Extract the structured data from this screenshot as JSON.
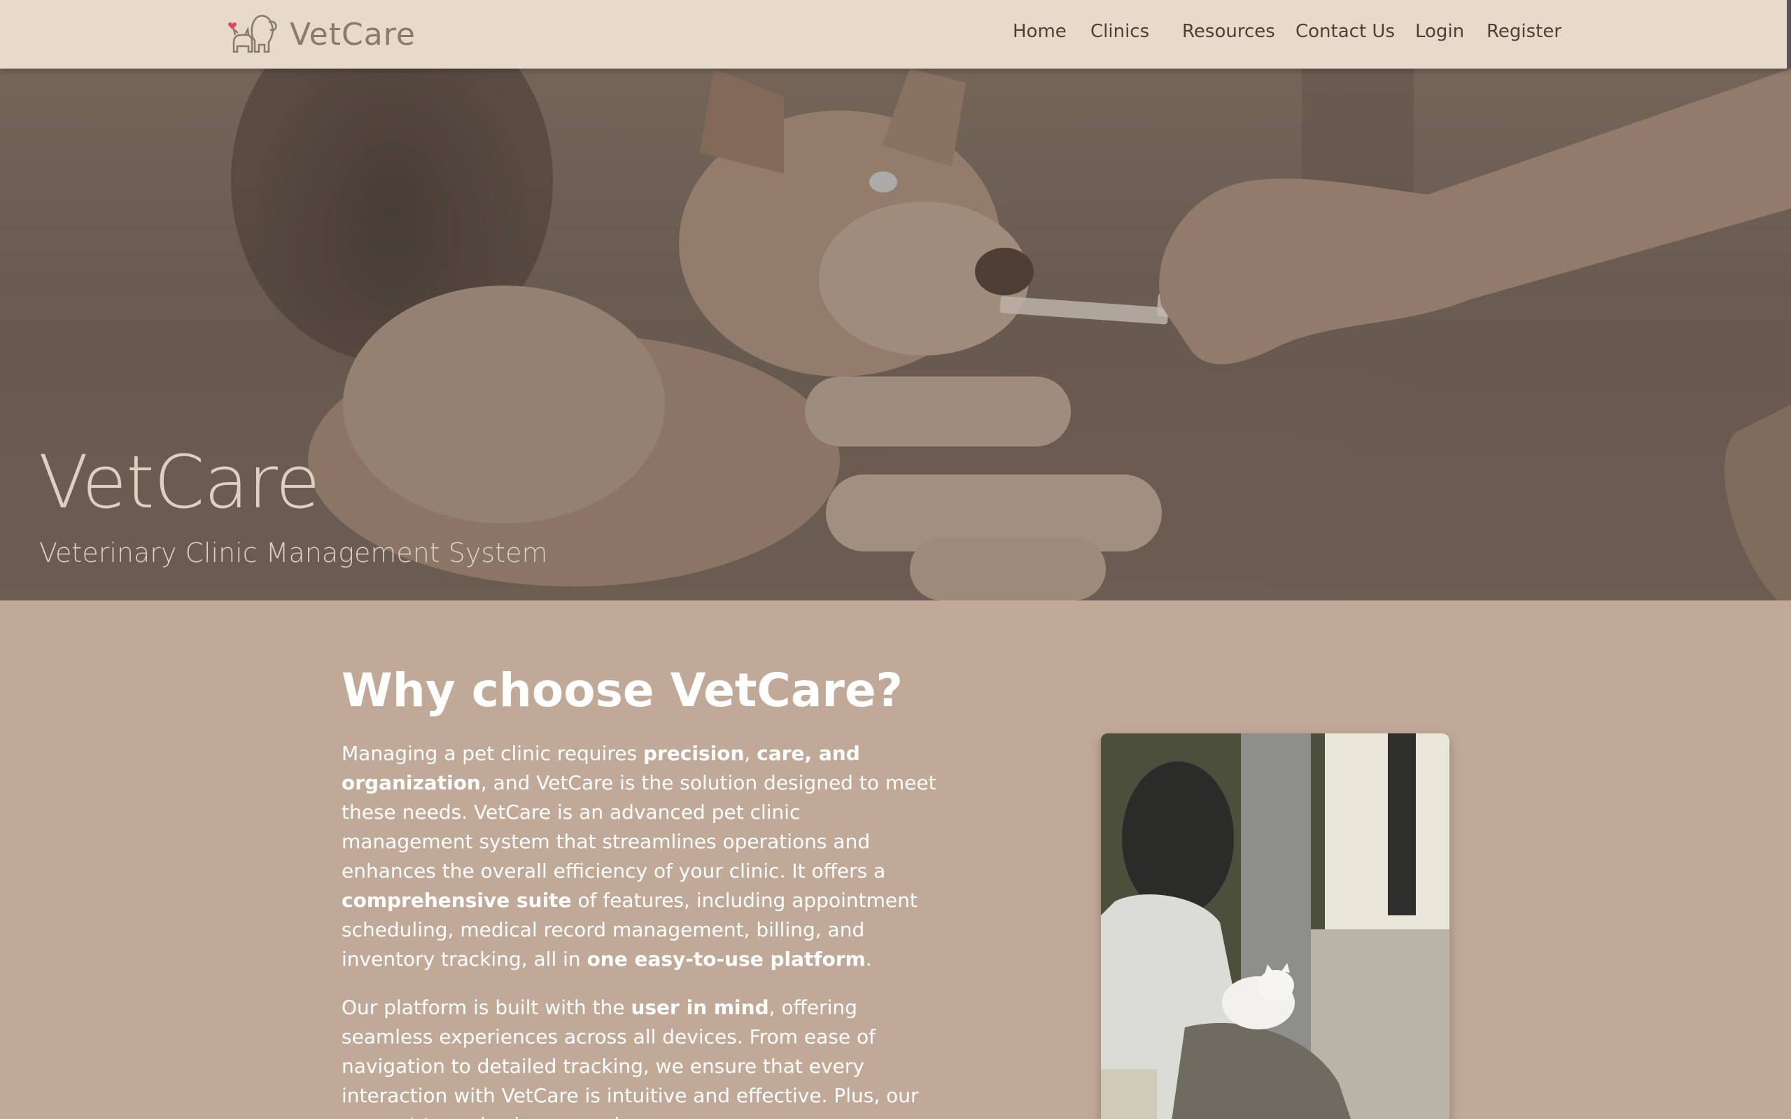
{
  "brand": {
    "name": "VetCare",
    "logo_icon": "dog-cat-heart-logo-icon"
  },
  "nav": {
    "items": [
      {
        "label": "Home"
      },
      {
        "label": "Clinics"
      },
      {
        "label": "Resources"
      },
      {
        "label": "Contact Us"
      },
      {
        "label": "Login"
      },
      {
        "label": "Register"
      }
    ]
  },
  "hero": {
    "title": "VetCare",
    "subtitle": "Veterinary Clinic Management System"
  },
  "why": {
    "title": "Why choose VetCare?",
    "p1": [
      {
        "t": "Managing a pet clinic requires "
      },
      {
        "t": "precision",
        "b": true
      },
      {
        "t": ", "
      },
      {
        "t": "care, and organization",
        "b": true
      },
      {
        "t": ", and VetCare is the solution designed to meet these needs. VetCare is an advanced pet clinic management system that streamlines operations and enhances the overall efficiency of your clinic. It offers a "
      },
      {
        "t": "comprehensive suite",
        "b": true
      },
      {
        "t": " of features, including appointment scheduling, medical record management, billing, and inventory tracking, all in "
      },
      {
        "t": "one easy-to-use platform",
        "b": true
      },
      {
        "t": "."
      }
    ],
    "p2": [
      {
        "t": "Our platform is built with the "
      },
      {
        "t": "user in mind",
        "b": true
      },
      {
        "t": ", offering seamless experiences across all devices. From ease of navigation to detailed tracking, we ensure that every interaction with VetCare is intuitive and effective. Plus, our support team is always ready"
      }
    ]
  },
  "colors": {
    "navbar_bg": "#e6dacb",
    "content_bg": "#c0aa97",
    "nav_text": "#4d4036",
    "brand_text": "#8a7a66",
    "heart": "#e0485a"
  }
}
